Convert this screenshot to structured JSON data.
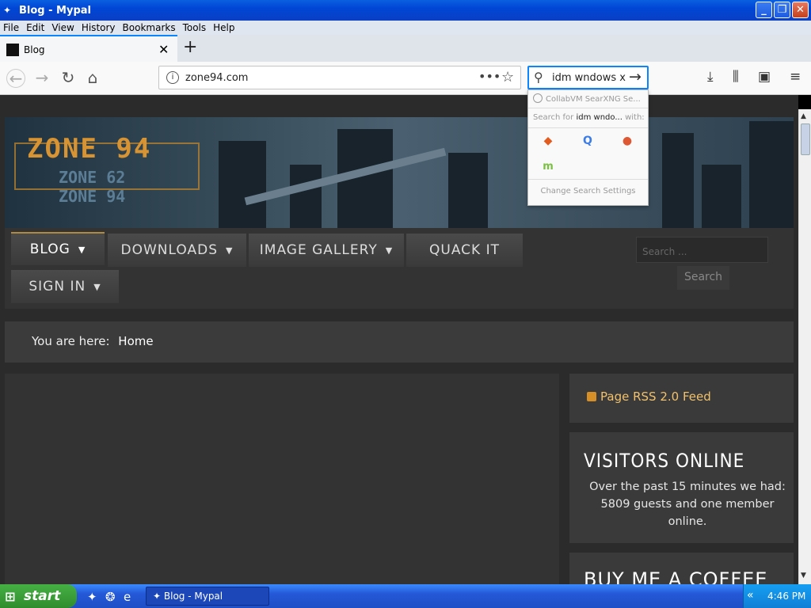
{
  "window": {
    "title": "Blog - Mypal",
    "icons": {
      "minimize": "_",
      "maximize": "❐",
      "close": "✕"
    }
  },
  "menu": [
    "File",
    "Edit",
    "View",
    "History",
    "Bookmarks",
    "Tools",
    "Help"
  ],
  "tabs": [
    {
      "label": "Blog"
    }
  ],
  "toolbar": {
    "url": "zone94.com",
    "search_query": "idm wndows x"
  },
  "search_dropdown": {
    "suggestion": "CollabVM SearXNG Se...",
    "search_for_prefix": "Search for",
    "search_for_query": "idm wndo...",
    "search_for_suffix": "with:",
    "engines": [
      "brave",
      "qwant",
      "duckduckgo",
      "mojeek"
    ],
    "settings_label": "Change Search Settings"
  },
  "site": {
    "logo_main": "ZONE 94",
    "logo_sub1": "ZONE 62",
    "logo_sub2": "ZONE 94",
    "nav": [
      {
        "label": "BLOG",
        "dropdown": true
      },
      {
        "label": "DOWNLOADS",
        "dropdown": true
      },
      {
        "label": "IMAGE GALLERY",
        "dropdown": true
      },
      {
        "label": "QUACK IT",
        "dropdown": false
      },
      {
        "label": "SIGN IN",
        "dropdown": true
      }
    ],
    "search_placeholder": "Search ...",
    "search_button": "Search",
    "breadcrumb_label": "You are here:",
    "breadcrumb_home": "Home",
    "rss_label": "Page RSS 2.0 Feed",
    "visitors_heading": "VISITORS ONLINE",
    "visitors_text": "Over the past 15 minutes we had: 5809 guests and one member online.",
    "coffee_heading": "BUY ME A COFFEE"
  },
  "taskbar": {
    "start_label": "start",
    "task_label": "Blog - Mypal",
    "clock": "4:46 PM"
  }
}
